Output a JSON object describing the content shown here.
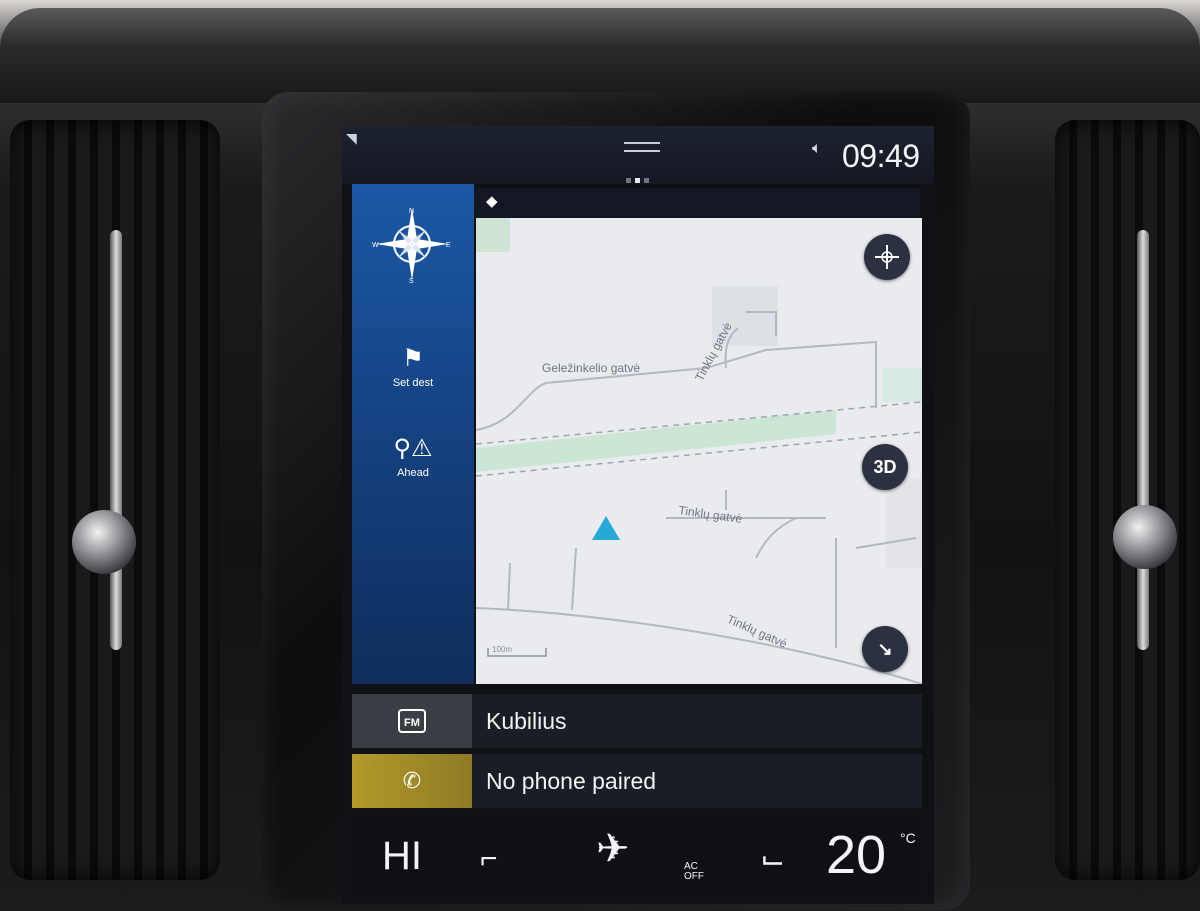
{
  "status_bar": {
    "time": "09:49",
    "mute_icon": "speaker-mute-icon",
    "signal_icon": "signal-icon"
  },
  "navigation": {
    "side_panel": {
      "compass_icon": "compass-rose-icon",
      "set_dest_label": "Set dest",
      "set_dest_icon": "checkered-flag-icon",
      "ahead_label": "Ahead",
      "ahead_icon": "pin-warning-icon"
    },
    "map": {
      "streets": [
        "Geležinkelio gatvė",
        "Tinklų gatvė",
        "Tinklų gatvė",
        "Tinklų gatvė"
      ],
      "buttons": {
        "compass": "compass-icon",
        "view_3d": "3D",
        "expand": "arrow-diagonal-icon"
      },
      "scale_label": "100m",
      "vehicle_icon": "vehicle-position-icon"
    }
  },
  "tiles": {
    "radio": {
      "icon": "fm-radio-icon",
      "icon_text": "FM",
      "label": "Kubilius"
    },
    "phone": {
      "icon": "phone-icon",
      "label": "No phone paired"
    }
  },
  "climate": {
    "fan_level": "HI",
    "ac_label": "AC",
    "ac_state": "OFF",
    "temperature": "20",
    "temperature_unit": "°C",
    "accent_color": "#2fa8e0"
  },
  "colors": {
    "nav_panel": "#1b58a5",
    "phone_accent": "#b49a2a",
    "vehicle_marker": "#27a9d8"
  }
}
